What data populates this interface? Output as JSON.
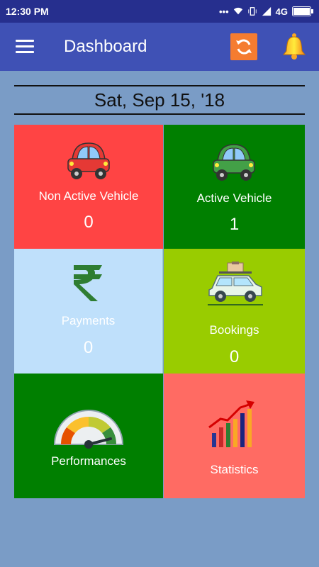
{
  "status_bar": {
    "time": "12:30 PM",
    "network": "4G"
  },
  "app_bar": {
    "title": "Dashboard",
    "menu_icon": "hamburger-menu-icon",
    "refresh_icon": "refresh-icon",
    "notification_icon": "bell-icon",
    "accent_color": "#3f51b5",
    "refresh_color": "#f57c30"
  },
  "date": {
    "text": "Sat, Sep 15, '18"
  },
  "tiles": [
    {
      "label": "Non Active Vehicle",
      "count": "0",
      "icon": "red-car-icon",
      "color": "#ff4444"
    },
    {
      "label": "Active Vehicle",
      "count": "1",
      "icon": "green-car-icon",
      "color": "#007f00"
    },
    {
      "label": "Payments",
      "count": "0",
      "icon": "rupee-icon",
      "color": "#bfe0fb"
    },
    {
      "label": "Bookings",
      "count": "0",
      "icon": "car-with-luggage-icon",
      "color": "#99cc00"
    },
    {
      "label": "Performances",
      "icon": "speedometer-gauge-icon",
      "color": "#007f00"
    },
    {
      "label": "Statistics",
      "icon": "bar-chart-growth-icon",
      "color": "#ff6b63"
    }
  ]
}
